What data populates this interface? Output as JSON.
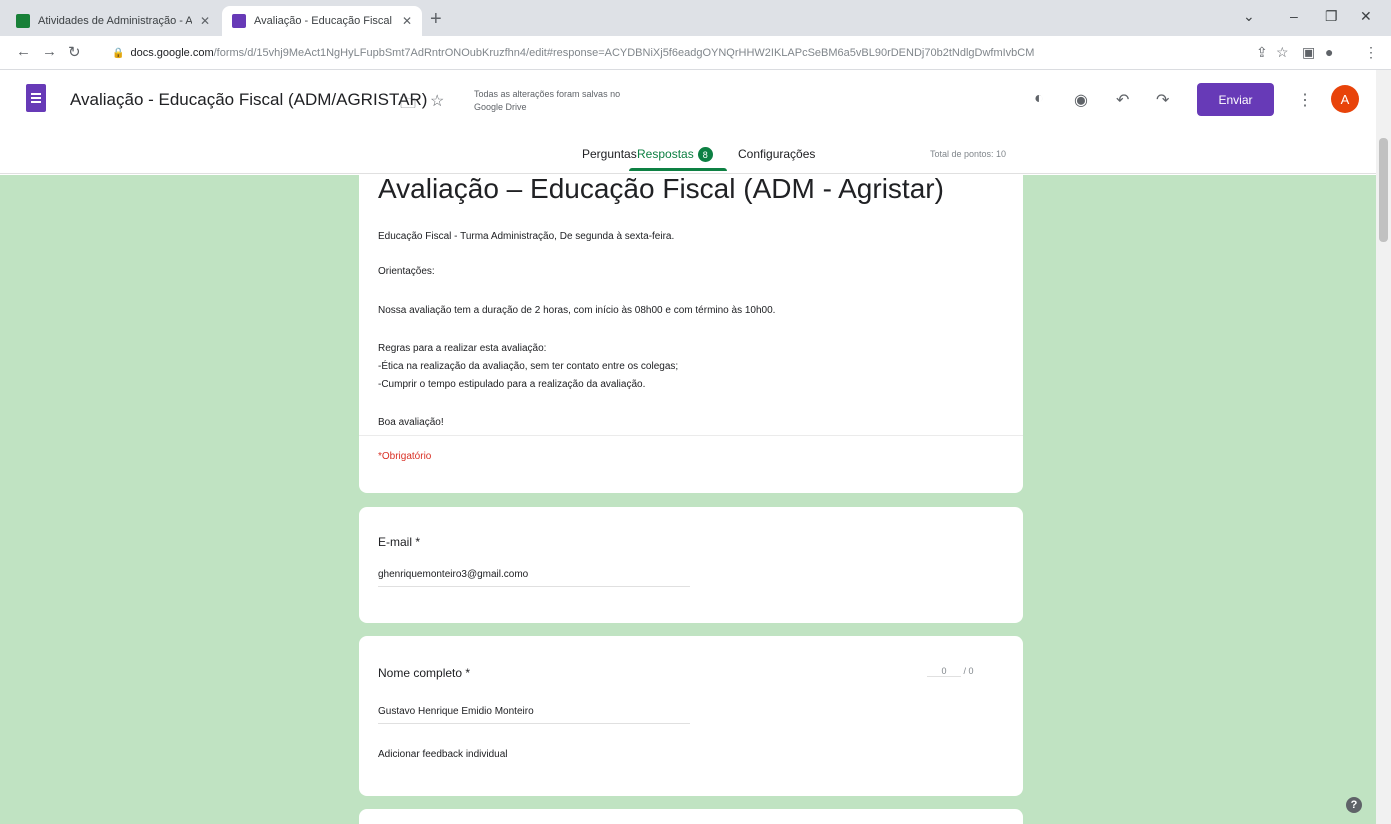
{
  "browser": {
    "tabs": [
      {
        "title": "Atividades de Administração - A",
        "favicon_color": "#188038"
      },
      {
        "title": "Avaliação - Educação Fiscal (AD",
        "favicon_color": "#673ab7"
      }
    ],
    "url_domain": "docs.google.com",
    "url_path": "/forms/d/15vhj9MeAct1NgHyLFupbSmt7AdRntrONOubKruzfhn4/edit#response=ACYDBNiXj5f6eadgOYNQrHHW2IKLAPcSeBM6a5vBL90rDENDj70b2tNdlgDwfmIvbCM"
  },
  "forms_header": {
    "doc_title": "Avaliação - Educação Fiscal (ADM/AGRISTAR)",
    "save_status": "Todas as alterações foram salvas no Google Drive",
    "send_label": "Enviar",
    "avatar_letter": "A",
    "tabs": [
      {
        "label": "Perguntas"
      },
      {
        "label": "Respostas",
        "badge": "8"
      },
      {
        "label": "Configurações"
      }
    ],
    "total_points": "Total de pontos: 10"
  },
  "form": {
    "title": "Avaliação – Educação Fiscal (ADM - Agristar)",
    "description_lines": [
      "Educação Fiscal - Turma Administração, De segunda à sexta-feira.",
      "Orientações:",
      "Nossa avaliação tem a duração de  2 horas, com início às 08h00 e com término às 10h00.",
      "Regras para a realizar esta avaliação:",
      "-Ética na realização da avaliação, sem ter contato entre os colegas;",
      "-Cumprir o tempo estipulado para a realização da avaliação.",
      "Boa avaliação!"
    ],
    "required_note": "*Obrigatório"
  },
  "questions": [
    {
      "label": "E-mail *",
      "answer": "ghenriquemonteiro3@gmail.como"
    },
    {
      "label": "Nome completo *",
      "answer": "Gustavo Henrique Emidio Monteiro",
      "score": "0",
      "score_max": "/ 0",
      "feedback": "Adicionar feedback individual"
    }
  ],
  "colors": {
    "accent": "#673ab7",
    "green": "#0d8043",
    "background": "#c0e3c2",
    "required": "#d93025"
  },
  "icons": [
    "folder-icon",
    "star-icon",
    "palette-icon",
    "preview-eye-icon",
    "undo-icon",
    "redo-icon",
    "more-vert-icon",
    "help-icon"
  ]
}
